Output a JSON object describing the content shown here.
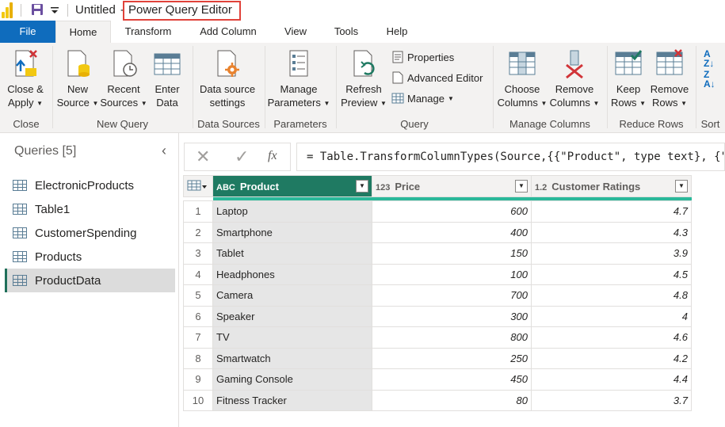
{
  "titlebar": {
    "untitled": "Untitled",
    "dash": "-",
    "editor_title": "Power Query Editor"
  },
  "tabs": [
    {
      "label": "File"
    },
    {
      "label": "Home"
    },
    {
      "label": "Transform"
    },
    {
      "label": "Add Column"
    },
    {
      "label": "View"
    },
    {
      "label": "Tools"
    },
    {
      "label": "Help"
    }
  ],
  "ribbon": {
    "close_apply": [
      "Close &",
      "Apply"
    ],
    "new_source": [
      "New",
      "Source"
    ],
    "recent_sources": [
      "Recent",
      "Sources"
    ],
    "enter_data": [
      "Enter",
      "Data"
    ],
    "data_source_settings": [
      "Data source",
      "settings"
    ],
    "manage_parameters": [
      "Manage",
      "Parameters"
    ],
    "refresh_preview": [
      "Refresh",
      "Preview"
    ],
    "properties": "Properties",
    "advanced_editor": "Advanced Editor",
    "manage": "Manage",
    "choose_columns": [
      "Choose",
      "Columns"
    ],
    "remove_columns": [
      "Remove",
      "Columns"
    ],
    "keep_rows": [
      "Keep",
      "Rows"
    ],
    "remove_rows": [
      "Remove",
      "Rows"
    ],
    "groups": {
      "close": "Close",
      "new_query": "New Query",
      "data_sources": "Data Sources",
      "parameters": "Parameters",
      "query": "Query",
      "manage_columns": "Manage Columns",
      "reduce_rows": "Reduce Rows",
      "sort": "Sort"
    }
  },
  "queries": {
    "header": "Queries [5]",
    "items": [
      {
        "label": "ElectronicProducts"
      },
      {
        "label": "Table1"
      },
      {
        "label": "CustomerSpending"
      },
      {
        "label": "Products"
      },
      {
        "label": "ProductData"
      }
    ]
  },
  "formula": {
    "fx": "fx",
    "text": "= Table.TransformColumnTypes(Source,{{\"Product\", type text}, {\"P"
  },
  "grid": {
    "columns": [
      {
        "type_icon": "ABC",
        "name": "Product"
      },
      {
        "type_icon": "123",
        "name": "Price"
      },
      {
        "type_icon": "1.2",
        "name": "Customer Ratings"
      }
    ],
    "rows": [
      {
        "n": "1",
        "product": "Laptop",
        "price": "600",
        "rating": "4.7"
      },
      {
        "n": "2",
        "product": "Smartphone",
        "price": "400",
        "rating": "4.3"
      },
      {
        "n": "3",
        "product": "Tablet",
        "price": "150",
        "rating": "3.9"
      },
      {
        "n": "4",
        "product": "Headphones",
        "price": "100",
        "rating": "4.5"
      },
      {
        "n": "5",
        "product": "Camera",
        "price": "700",
        "rating": "4.8"
      },
      {
        "n": "6",
        "product": "Speaker",
        "price": "300",
        "rating": "4"
      },
      {
        "n": "7",
        "product": "TV",
        "price": "800",
        "rating": "4.6"
      },
      {
        "n": "8",
        "product": "Smartwatch",
        "price": "250",
        "rating": "4.2"
      },
      {
        "n": "9",
        "product": "Gaming Console",
        "price": "450",
        "rating": "4.4"
      },
      {
        "n": "10",
        "product": "Fitness Tracker",
        "price": "80",
        "rating": "3.7"
      }
    ]
  },
  "colors": {
    "accent": "#0f6cbd",
    "product_header": "#1f7a62",
    "quality_bar": "#2ab89a",
    "highlight_box": "#e0423a"
  }
}
